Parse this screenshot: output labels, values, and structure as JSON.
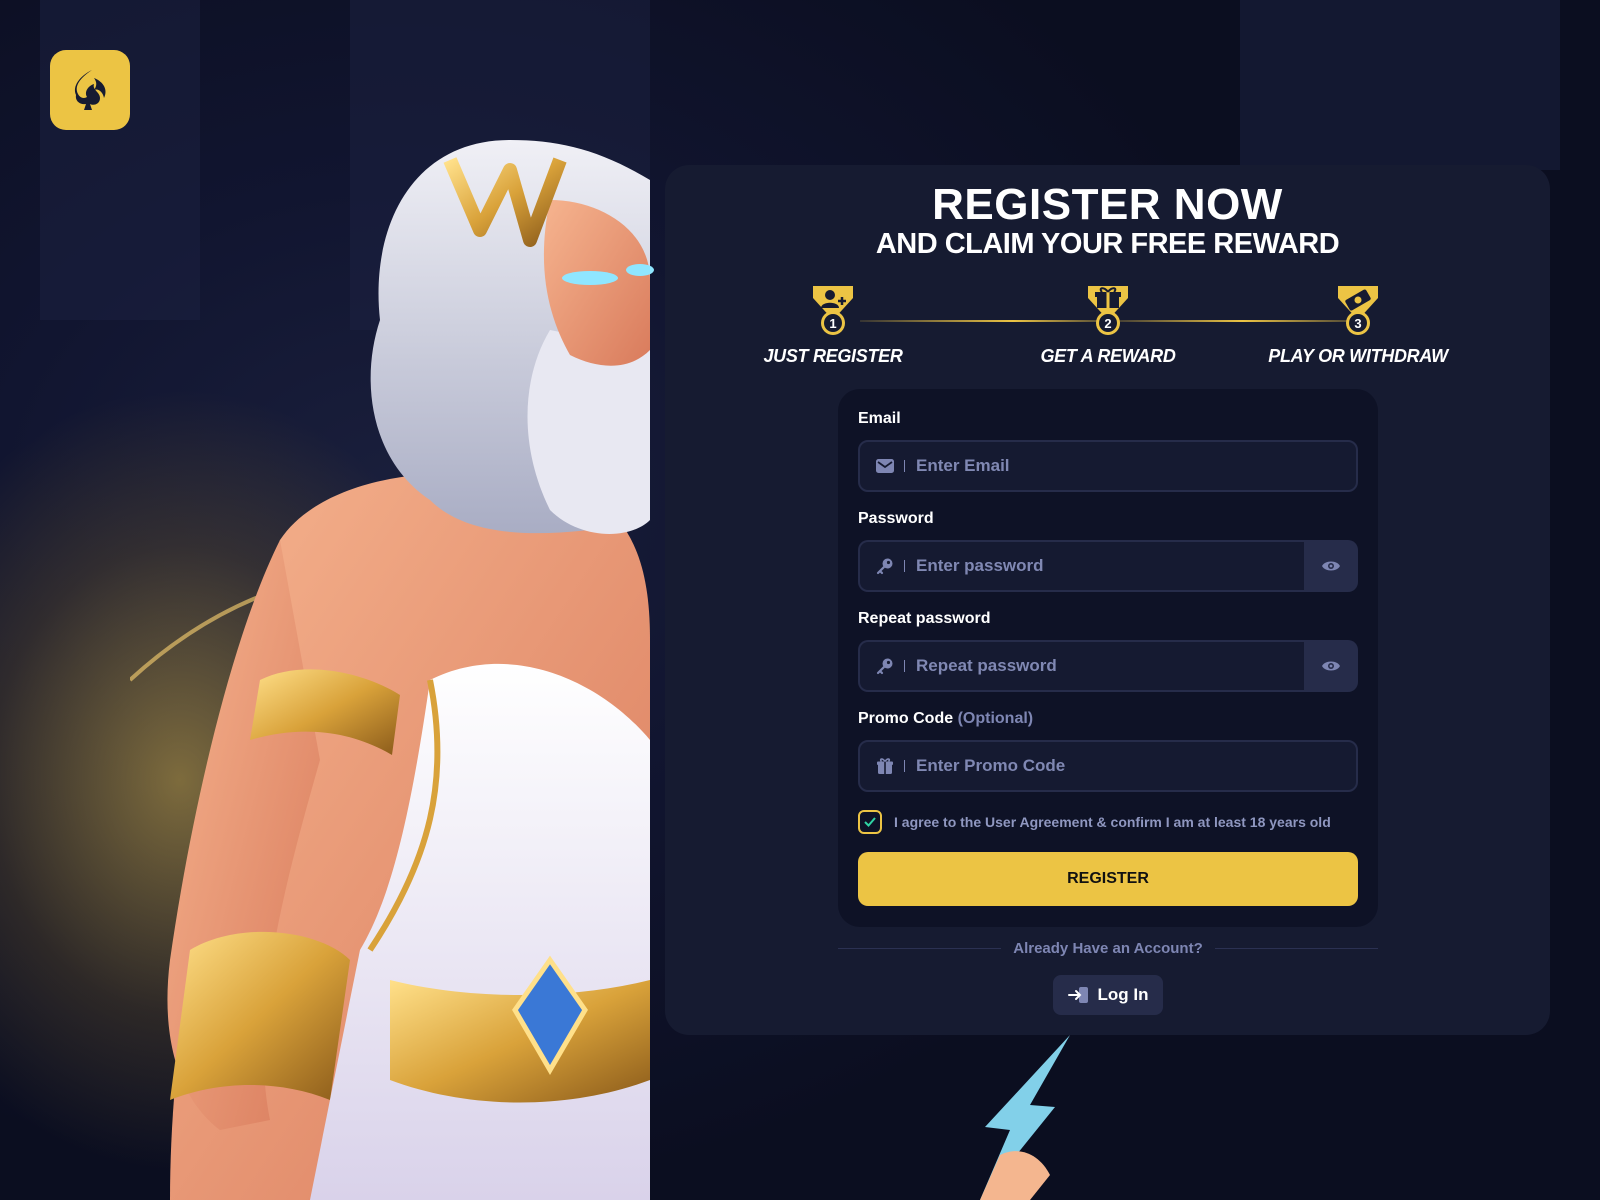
{
  "brand": {
    "logo_icon": "spade-flame-icon",
    "accent_color": "#ecc444"
  },
  "header": {
    "title": "REGISTER NOW",
    "subtitle": "AND CLAIM YOUR FREE REWARD"
  },
  "steps": [
    {
      "number": "1",
      "label": "JUST REGISTER",
      "icon": "user-plus-icon"
    },
    {
      "number": "2",
      "label": "GET A REWARD",
      "icon": "gift-icon"
    },
    {
      "number": "3",
      "label": "PLAY OR WITHDRAW",
      "icon": "cash-icon"
    }
  ],
  "form": {
    "email": {
      "label": "Email",
      "placeholder": "Enter Email",
      "icon": "envelope-icon"
    },
    "password": {
      "label": "Password",
      "placeholder": "Enter password",
      "icon": "key-icon"
    },
    "repeat_password": {
      "label": "Repeat password",
      "placeholder": "Repeat password",
      "icon": "key-icon"
    },
    "promo": {
      "label": "Promo Code",
      "optional": "(Optional)",
      "placeholder": "Enter Promo Code",
      "icon": "gift-icon"
    },
    "agree_text": "I agree to the User Agreement & confirm I am at least 18 years old",
    "agree_checked": true,
    "register_label": "REGISTER"
  },
  "footer": {
    "already_text": "Already Have an Account?",
    "login_label": "Log In"
  }
}
